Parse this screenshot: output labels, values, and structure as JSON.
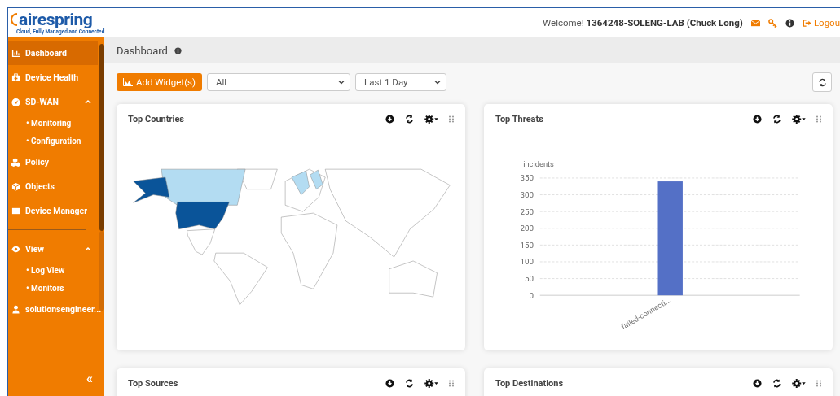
{
  "header": {
    "logo": {
      "name": "airespring",
      "tagline": "Cloud, Fully Managed and Connected"
    },
    "welcome": "Welcome!",
    "account": "1364248-SOLENG-LAB (Chuck Long)",
    "logout": "Logou"
  },
  "sidebar": {
    "items": [
      {
        "kind": "item",
        "label": "Dashboard",
        "selected": true
      },
      {
        "kind": "item",
        "label": "Device Health",
        "selected": false
      },
      {
        "kind": "item",
        "label": "SD-WAN",
        "selected": false,
        "expanded": true,
        "children": [
          {
            "label": "• Monitoring",
            "selected": false
          },
          {
            "label": "• Configuration",
            "selected": false
          }
        ]
      },
      {
        "kind": "item",
        "label": "Policy",
        "selected": false
      },
      {
        "kind": "item",
        "label": "Objects",
        "selected": false
      },
      {
        "kind": "item",
        "label": "Device Manager",
        "selected": false
      },
      {
        "kind": "divider"
      },
      {
        "kind": "item",
        "label": "View",
        "selected": false,
        "expanded": true,
        "children": [
          {
            "label": "• Log View",
            "selected": false
          },
          {
            "label": "• Monitors",
            "selected": false
          }
        ]
      },
      {
        "kind": "item",
        "label": "solutionsengineer...",
        "selected": false
      }
    ],
    "collapse": "«"
  },
  "page": {
    "title": "Dashboard"
  },
  "toolbar": {
    "add_button": "Add Widget(s)",
    "filter": "All",
    "range": "Last 1 Day"
  },
  "widgets": [
    {
      "kind": "map",
      "title": "Top Countries"
    },
    {
      "kind": "chart",
      "title": "Top Threats",
      "chart_data": {
        "type": "bar",
        "ylabel": "incidents",
        "categories": [
          "failed-connecti..."
        ],
        "grid": true,
        "series": [
          {
            "color": "#5470c6",
            "values": [
              340
            ]
          }
        ],
        "ylim": [
          0,
          350
        ],
        "yticks": [
          0,
          50,
          100,
          150,
          200,
          250,
          300,
          350
        ]
      }
    },
    {
      "kind": "empty",
      "title": "Top Sources"
    },
    {
      "kind": "empty",
      "title": "Top Destinations"
    }
  ]
}
